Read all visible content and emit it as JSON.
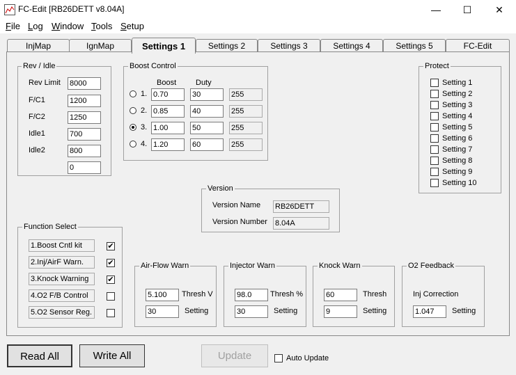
{
  "window": {
    "title": "FC-Edit [RB26DETT v8.04A]",
    "minimize": "—",
    "maximize": "☐",
    "close": "✕"
  },
  "menu": [
    "File",
    "Log",
    "Window",
    "Tools",
    "Setup"
  ],
  "tabs": [
    "InjMap",
    "IgnMap",
    "Settings 1",
    "Settings 2",
    "Settings 3",
    "Settings 4",
    "Settings 5",
    "FC-Edit"
  ],
  "rev_idle": {
    "title": "Rev / Idle",
    "rows": [
      {
        "label": "Rev Limit",
        "value": "8000"
      },
      {
        "label": "F/C1",
        "value": "1200"
      },
      {
        "label": "F/C2",
        "value": "1250"
      },
      {
        "label": "Idle1",
        "value": "700"
      },
      {
        "label": "Idle2",
        "value": "800"
      },
      {
        "label": "",
        "value": "0"
      }
    ]
  },
  "boost": {
    "title": "Boost Control",
    "col_boost": "Boost",
    "col_duty": "Duty",
    "rows": [
      {
        "num": "1.",
        "boost": "0.70",
        "duty": "30",
        "raw": "255",
        "selected": false
      },
      {
        "num": "2.",
        "boost": "0.85",
        "duty": "40",
        "raw": "255",
        "selected": false
      },
      {
        "num": "3.",
        "boost": "1.00",
        "duty": "50",
        "raw": "255",
        "selected": true
      },
      {
        "num": "4.",
        "boost": "1.20",
        "duty": "60",
        "raw": "255",
        "selected": false
      }
    ]
  },
  "protect": {
    "title": "Protect",
    "items": [
      "Setting 1",
      "Setting 2",
      "Setting 3",
      "Setting 4",
      "Setting 5",
      "Setting 6",
      "Setting 7",
      "Setting 8",
      "Setting 9",
      "Setting 10"
    ]
  },
  "version": {
    "title": "Version",
    "name_label": "Version Name",
    "name_value": "RB26DETT",
    "number_label": "Version Number",
    "number_value": "8.04A"
  },
  "function_select": {
    "title": "Function Select",
    "items": [
      {
        "label": "1.Boost Cntl kit",
        "checked": true
      },
      {
        "label": "2.Inj/AirF Warn.",
        "checked": true
      },
      {
        "label": "3.Knock Warning",
        "checked": true
      },
      {
        "label": "4.O2 F/B Control",
        "checked": false
      },
      {
        "label": "5.O2 Sensor Reg.",
        "checked": false
      }
    ]
  },
  "airflow": {
    "title": "Air-Flow Warn",
    "v1": "5.100",
    "l1": "Thresh V",
    "v2": "30",
    "l2": "Setting"
  },
  "injector": {
    "title": "Injector Warn",
    "v1": "98.0",
    "l1": "Thresh %",
    "v2": "30",
    "l2": "Setting"
  },
  "knock": {
    "title": "Knock Warn",
    "v1": "60",
    "l1": "Thresh",
    "v2": "9",
    "l2": "Setting"
  },
  "o2": {
    "title": "O2 Feedback",
    "l0": "Inj Correction",
    "v2": "1.047",
    "l2": "Setting"
  },
  "buttons": {
    "read_all": "Read All",
    "write_all": "Write All",
    "update": "Update",
    "auto_update": "Auto Update"
  }
}
